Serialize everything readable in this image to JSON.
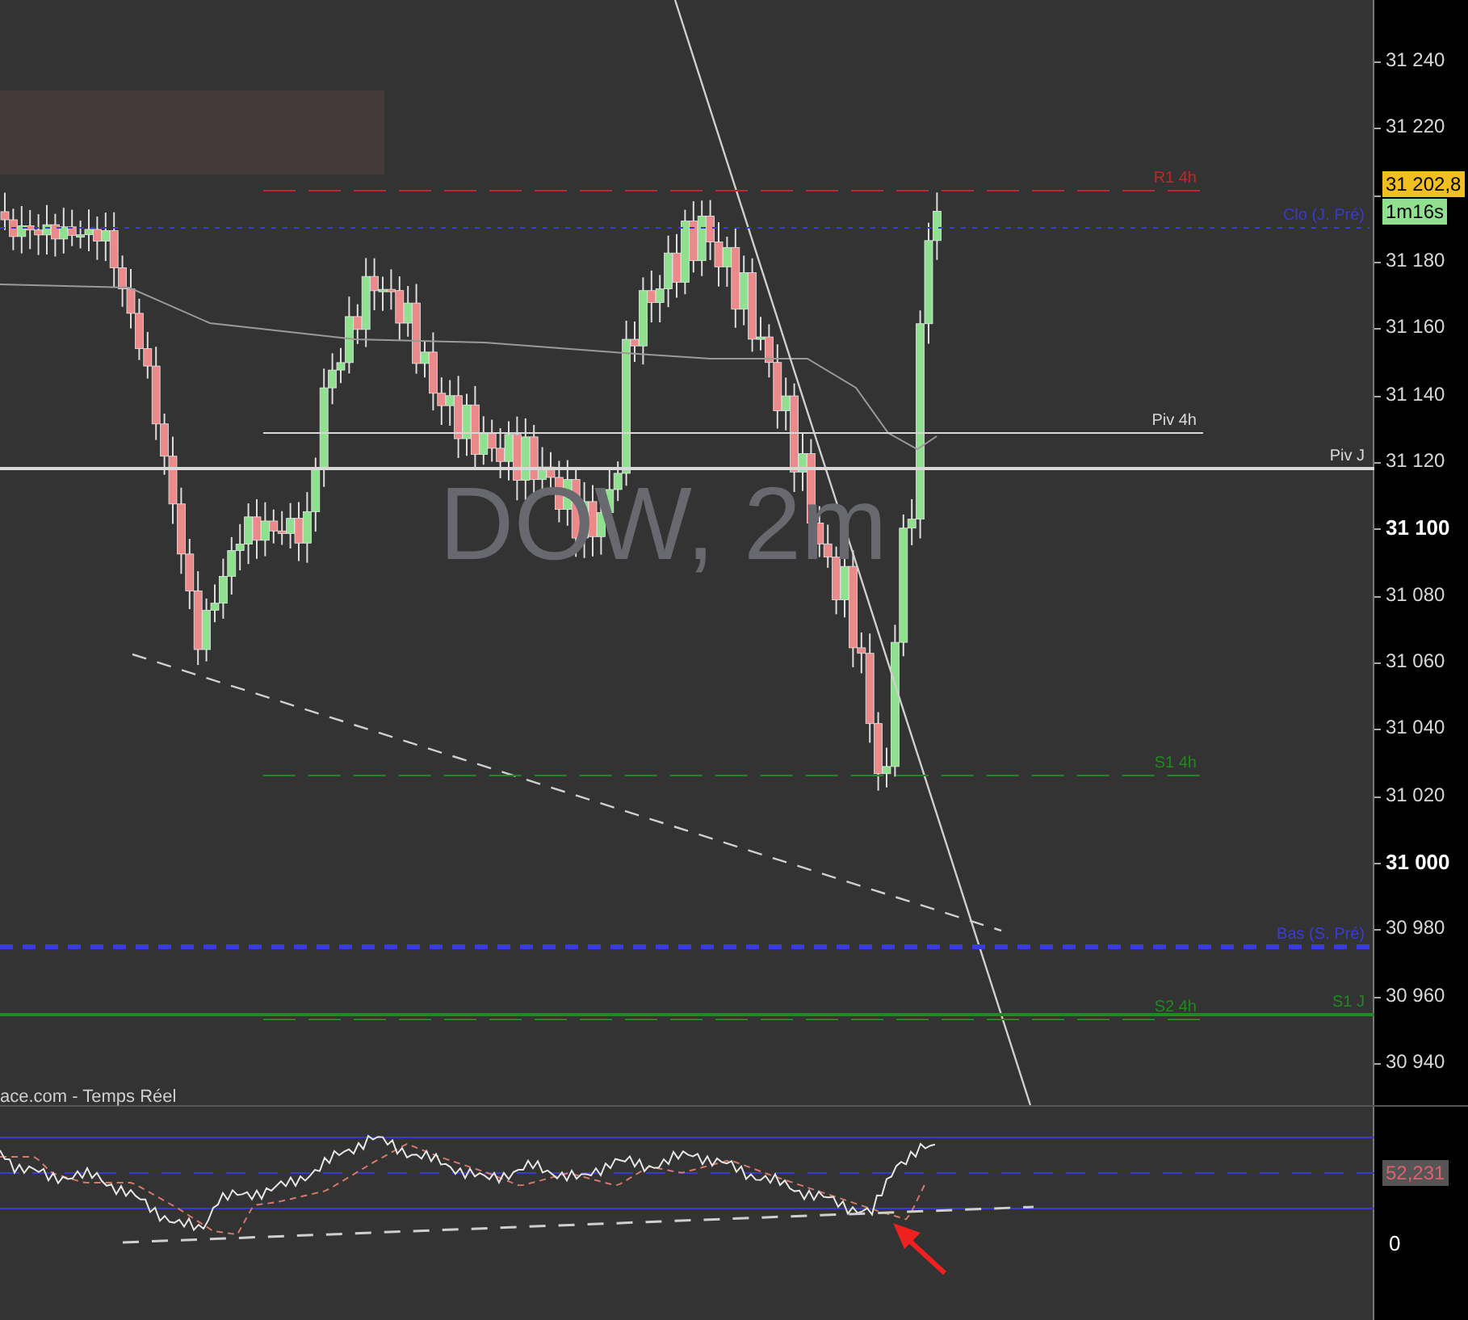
{
  "chart": {
    "watermark": "DOW, 2m",
    "source": "ace.com - Temps Réel"
  },
  "levels": [
    {
      "label": "R1 4h",
      "kind": "dashed",
      "color": "#c0262b"
    },
    {
      "label": "Clo (J. Pré)",
      "kind": "dotted",
      "color": "#3a3acc"
    },
    {
      "label": "Piv 4h",
      "kind": "solid",
      "color": "#d8d8d8"
    },
    {
      "label": "Piv J",
      "kind": "bold",
      "color": "#d8d8d8"
    },
    {
      "label": "S1 4h",
      "kind": "dashed",
      "color": "#1f8a1f"
    },
    {
      "label": "Bas (S. Pré)",
      "kind": "bold-dashed",
      "color": "#3a3ae0"
    },
    {
      "label": "S2 4h",
      "kind": "dashed",
      "color": "#1f8a1f"
    },
    {
      "label": "S1 J",
      "kind": "bold",
      "color": "#1f8a1f"
    }
  ],
  "price_axis": {
    "ticks": [
      {
        "label": "31 240",
        "bold": false
      },
      {
        "label": "31 220",
        "bold": false
      },
      {
        "label": "31 180",
        "bold": false
      },
      {
        "label": "31 160",
        "bold": false
      },
      {
        "label": "31 140",
        "bold": false
      },
      {
        "label": "31 120",
        "bold": false
      },
      {
        "label": "31 100",
        "bold": true
      },
      {
        "label": "31 080",
        "bold": false
      },
      {
        "label": "31 060",
        "bold": false
      },
      {
        "label": "31 040",
        "bold": false
      },
      {
        "label": "31 020",
        "bold": false
      },
      {
        "label": "31 000",
        "bold": true
      },
      {
        "label": "30 980",
        "bold": false
      },
      {
        "label": "30 960",
        "bold": false
      },
      {
        "label": "30 940",
        "bold": false
      }
    ],
    "last_price": "31 202,8",
    "countdown": "1m16s"
  },
  "rsi_axis": {
    "value": "52,231",
    "tick": "0"
  }
}
